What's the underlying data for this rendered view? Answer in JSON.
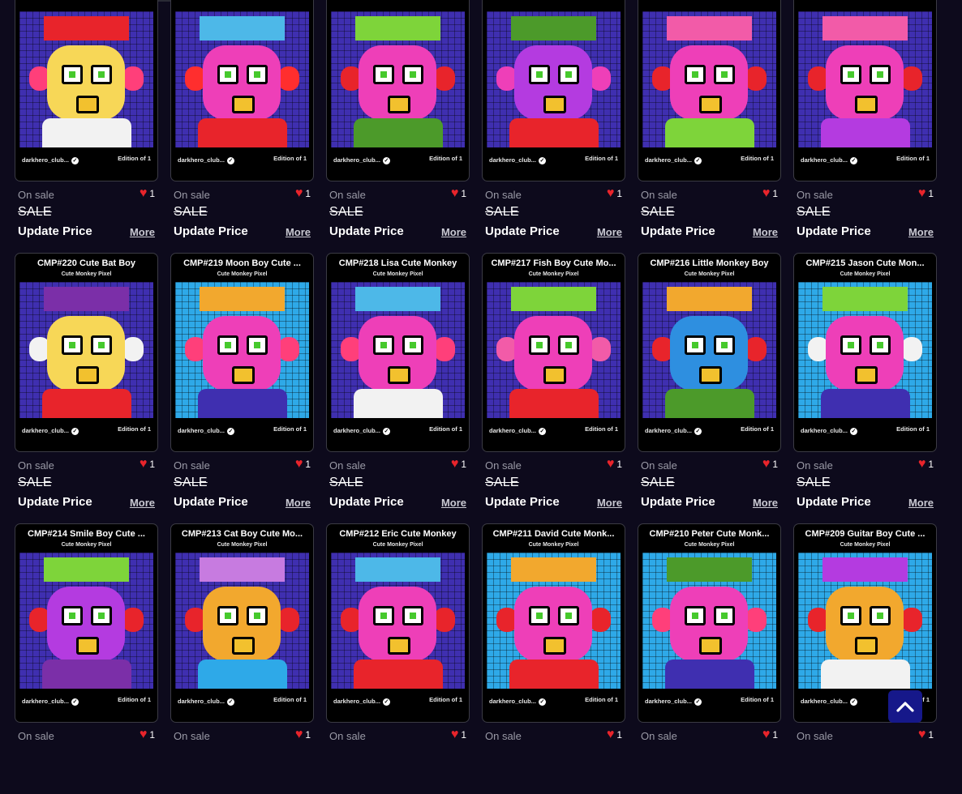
{
  "cards": [
    {
      "title": "",
      "subtitle": "",
      "owner": "darkhero_club...",
      "edition": "Edition of 1",
      "status": "On sale",
      "likes": "1",
      "sale": "SALE",
      "update_label": "Update Price",
      "more_label": "More",
      "palette": {
        "bg": "#3f2fb0",
        "face": "#f7d757",
        "ear": "#ff3f7a",
        "hat": "#e8242b",
        "body": "#f2f2f2"
      }
    },
    {
      "title": "",
      "subtitle": "",
      "owner": "darkhero_club...",
      "edition": "Edition of 1",
      "status": "On sale",
      "likes": "1",
      "sale": "SALE",
      "update_label": "Update Price",
      "more_label": "More",
      "palette": {
        "bg": "#3f2fb0",
        "face": "#ee3fb8",
        "ear": "#ff2e2e",
        "hat": "#4db8e8",
        "body": "#e8242b"
      }
    },
    {
      "title": "",
      "subtitle": "",
      "owner": "darkhero_club...",
      "edition": "Edition of 1",
      "status": "On sale",
      "likes": "1",
      "sale": "SALE",
      "update_label": "Update Price",
      "more_label": "More",
      "palette": {
        "bg": "#3f2fb0",
        "face": "#ee3fb8",
        "ear": "#e8242b",
        "hat": "#7ed43a",
        "body": "#4c9a2a"
      }
    },
    {
      "title": "",
      "subtitle": "",
      "owner": "darkhero_club...",
      "edition": "Edition of 1",
      "status": "On sale",
      "likes": "1",
      "sale": "SALE",
      "update_label": "Update Price",
      "more_label": "More",
      "palette": {
        "bg": "#3f2fb0",
        "face": "#b43be0",
        "ear": "#ee3fb8",
        "hat": "#4c9a2a",
        "body": "#e8242b"
      }
    },
    {
      "title": "",
      "subtitle": "",
      "owner": "darkhero_club...",
      "edition": "Edition of 1",
      "status": "On sale",
      "likes": "1",
      "sale": "SALE",
      "update_label": "Update Price",
      "more_label": "More",
      "palette": {
        "bg": "#3f2fb0",
        "face": "#ee3fb8",
        "ear": "#e8242b",
        "hat": "#f25ba8",
        "body": "#7ed43a"
      }
    },
    {
      "title": "",
      "subtitle": "",
      "owner": "darkhero_club...",
      "edition": "Edition of 1",
      "status": "On sale",
      "likes": "1",
      "sale": "SALE",
      "update_label": "Update Price",
      "more_label": "More",
      "palette": {
        "bg": "#3f2fb0",
        "face": "#ee3fb8",
        "ear": "#e8242b",
        "hat": "#f25ba8",
        "body": "#b43be0"
      }
    },
    {
      "title": "CMP#220 Cute Bat Boy",
      "subtitle": "Cute Monkey Pixel",
      "owner": "darkhero_club...",
      "edition": "Edition of 1",
      "status": "On sale",
      "likes": "1",
      "sale": "SALE",
      "update_label": "Update Price",
      "more_label": "More",
      "palette": {
        "bg": "#3f2fb0",
        "face": "#f7d757",
        "ear": "#f2f2f2",
        "hat": "#7b2fa8",
        "body": "#e8242b"
      }
    },
    {
      "title": "CMP#219 Moon Boy Cute ...",
      "subtitle": "Cute Monkey Pixel",
      "owner": "darkhero_club...",
      "edition": "Edition of 1",
      "status": "On sale",
      "likes": "1",
      "sale": "SALE",
      "update_label": "Update Price",
      "more_label": "More",
      "palette": {
        "bg": "#2ea9e8",
        "face": "#ee3fb8",
        "ear": "#ff3f7a",
        "hat": "#f2a82e",
        "body": "#3f2fb0"
      }
    },
    {
      "title": "CMP#218 Lisa Cute Monkey",
      "subtitle": "Cute Monkey Pixel",
      "owner": "darkhero_club...",
      "edition": "Edition of 1",
      "status": "On sale",
      "likes": "1",
      "sale": "SALE",
      "update_label": "Update Price",
      "more_label": "More",
      "palette": {
        "bg": "#3f2fb0",
        "face": "#ee3fb8",
        "ear": "#ff3f7a",
        "hat": "#4db8e8",
        "body": "#f2f2f2"
      }
    },
    {
      "title": "CMP#217 Fish Boy Cute Mo...",
      "subtitle": "Cute Monkey Pixel",
      "owner": "darkhero_club...",
      "edition": "Edition of 1",
      "status": "On sale",
      "likes": "1",
      "sale": "SALE",
      "update_label": "Update Price",
      "more_label": "More",
      "palette": {
        "bg": "#3f2fb0",
        "face": "#ee3fb8",
        "ear": "#f25ba8",
        "hat": "#7ed43a",
        "body": "#e8242b"
      }
    },
    {
      "title": "CMP#216 Little Monkey Boy",
      "subtitle": "Cute Monkey Pixel",
      "owner": "darkhero_club...",
      "edition": "Edition of 1",
      "status": "On sale",
      "likes": "1",
      "sale": "SALE",
      "update_label": "Update Price",
      "more_label": "More",
      "palette": {
        "bg": "#3f2fb0",
        "face": "#2e8fe0",
        "ear": "#e8242b",
        "hat": "#f2a82e",
        "body": "#4c9a2a"
      }
    },
    {
      "title": "CMP#215 Jason Cute Mon...",
      "subtitle": "Cute Monkey Pixel",
      "owner": "darkhero_club...",
      "edition": "Edition of 1",
      "status": "On sale",
      "likes": "1",
      "sale": "SALE",
      "update_label": "Update Price",
      "more_label": "More",
      "palette": {
        "bg": "#2ea9e8",
        "face": "#ee3fb8",
        "ear": "#f2f2f2",
        "hat": "#7ed43a",
        "body": "#3f2fb0"
      }
    },
    {
      "title": "CMP#214 Smile Boy Cute ...",
      "subtitle": "Cute Monkey Pixel",
      "owner": "darkhero_club...",
      "edition": "Edition of 1",
      "status": "On sale",
      "likes": "1",
      "sale": "",
      "update_label": "",
      "more_label": "",
      "palette": {
        "bg": "#3f2fb0",
        "face": "#b43be0",
        "ear": "#e8242b",
        "hat": "#7ed43a",
        "body": "#7b2fa8"
      }
    },
    {
      "title": "CMP#213 Cat Boy Cute Mo...",
      "subtitle": "Cute Monkey Pixel",
      "owner": "darkhero_club...",
      "edition": "Edition of 1",
      "status": "On sale",
      "likes": "1",
      "sale": "",
      "update_label": "",
      "more_label": "",
      "palette": {
        "bg": "#3f2fb0",
        "face": "#f2a82e",
        "ear": "#e8242b",
        "hat": "#c77be0",
        "body": "#2ea9e8"
      }
    },
    {
      "title": "CMP#212 Eric Cute Monkey",
      "subtitle": "Cute Monkey Pixel",
      "owner": "darkhero_club...",
      "edition": "Edition of 1",
      "status": "On sale",
      "likes": "1",
      "sale": "",
      "update_label": "",
      "more_label": "",
      "palette": {
        "bg": "#3f2fb0",
        "face": "#ee3fb8",
        "ear": "#e8242b",
        "hat": "#4db8e8",
        "body": "#e8242b"
      }
    },
    {
      "title": "CMP#211 David Cute Monk...",
      "subtitle": "Cute Monkey Pixel",
      "owner": "darkhero_club...",
      "edition": "Edition of 1",
      "status": "On sale",
      "likes": "1",
      "sale": "",
      "update_label": "",
      "more_label": "",
      "palette": {
        "bg": "#2ea9e8",
        "face": "#ee3fb8",
        "ear": "#e8242b",
        "hat": "#f2a82e",
        "body": "#e8242b"
      }
    },
    {
      "title": "CMP#210 Peter Cute Monk...",
      "subtitle": "Cute Monkey Pixel",
      "owner": "darkhero_club...",
      "edition": "Edition of 1",
      "status": "On sale",
      "likes": "1",
      "sale": "",
      "update_label": "",
      "more_label": "",
      "palette": {
        "bg": "#2ea9e8",
        "face": "#ee3fb8",
        "ear": "#ff3f7a",
        "hat": "#4c9a2a",
        "body": "#3f2fb0"
      }
    },
    {
      "title": "CMP#209 Guitar Boy Cute ...",
      "subtitle": "Cute Monkey Pixel",
      "owner": "darkhero_club...",
      "edition": "Edition of 1",
      "status": "On sale",
      "likes": "1",
      "sale": "",
      "update_label": "",
      "more_label": "",
      "palette": {
        "bg": "#2ea9e8",
        "face": "#f2a82e",
        "ear": "#e8242b",
        "hat": "#b43be0",
        "body": "#f2f2f2"
      }
    }
  ],
  "scroll_top": {
    "icon": "chevron-up-icon"
  }
}
